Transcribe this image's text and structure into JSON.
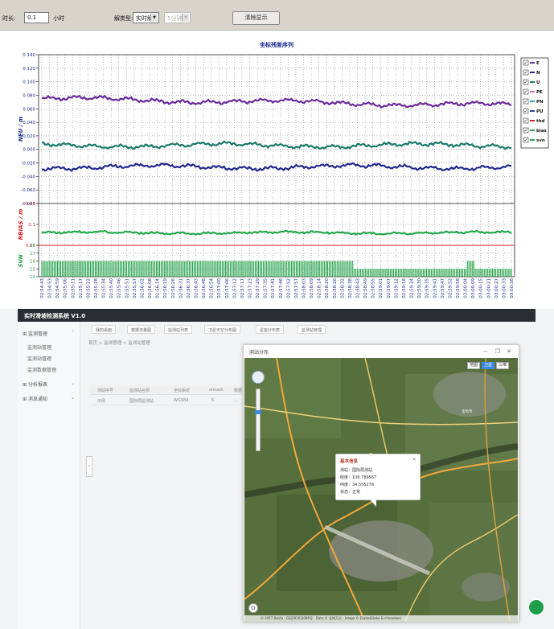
{
  "toolbar": {
    "duration_label": "时长:",
    "duration_value": "0.1",
    "duration_unit": "小时",
    "solution_label": "解类型:",
    "solution_value": "实时解",
    "interval_value": "5分钟",
    "clear_button": "清除显示"
  },
  "chart_data": {
    "type": "line",
    "title": "坐标残差序列",
    "panels": [
      {
        "ylabel": "NEU / m",
        "ylim": [
          -0.08,
          0.14
        ],
        "ticks": [
          -0.08,
          -0.06,
          -0.04,
          -0.02,
          0.0,
          0.02,
          0.04,
          0.06,
          0.08,
          0.1,
          0.12,
          0.14
        ],
        "tick_labels": [
          "-0.080",
          "-0.060",
          "-0.040",
          "-0.020",
          "0.000",
          "0.020",
          "0.040",
          "0.060",
          "0.080",
          "0.100",
          "0.120",
          "0.140"
        ]
      },
      {
        "ylabel": "RBIAS / m",
        "ylim": [
          0.05,
          0.15
        ],
        "ticks": [
          0.05,
          0.1,
          0.15
        ],
        "tick_labels": [
          "0.05",
          "0.1",
          "0.15"
        ]
      },
      {
        "ylabel": "SVN",
        "ylim": [
          14,
          18
        ],
        "ticks": [
          14,
          15,
          16,
          17,
          18
        ],
        "tick_labels": [
          "14",
          "15",
          "16",
          "17",
          "18"
        ]
      }
    ],
    "series": [
      {
        "name": "E",
        "panel": 0,
        "color": "#6a2a9c",
        "level": 0.075
      },
      {
        "name": "U",
        "panel": 0,
        "color": "#1a7a6a",
        "level": 0.006
      },
      {
        "name": "N",
        "panel": 0,
        "color": "#232a8f",
        "level": -0.026
      },
      {
        "name": "bias",
        "panel": 1,
        "color": "#22a84a",
        "level": 0.08
      },
      {
        "name": "thd",
        "panel": 1,
        "color": "#e02020",
        "level": 0.05
      },
      {
        "name": "svn",
        "panel": 2,
        "color": "#26a34a",
        "level": 16
      }
    ],
    "x_tick_labels": [
      "02:54:43",
      "02:54:53",
      "02:54:59",
      "02:55:06",
      "02:55:11",
      "02:55:17",
      "02:55:22",
      "02:55:28",
      "02:55:34",
      "02:55:40",
      "02:55:46",
      "02:55:51",
      "02:55:57",
      "02:56:02",
      "02:56:08",
      "02:56:14",
      "02:56:19",
      "02:56:26",
      "02:56:31",
      "02:56:37",
      "02:56:43",
      "02:56:48",
      "02:56:54",
      "02:57:00",
      "02:57:06",
      "02:57:12",
      "02:57:17",
      "02:57:23",
      "02:57:29",
      "02:57:35",
      "02:57:41",
      "02:57:46",
      "02:57:52",
      "02:57:57",
      "02:58:03",
      "02:58:09",
      "02:58:14",
      "02:58:20",
      "02:58:26",
      "02:58:32",
      "02:58:38",
      "02:58:43",
      "02:58:49",
      "02:58:55",
      "02:59:01",
      "02:59:07",
      "02:59:12",
      "02:59:18",
      "02:59:24",
      "02:59:30",
      "02:59:35",
      "02:59:41",
      "02:59:47",
      "02:59:52",
      "02:59:58",
      "03:00:04",
      "03:00:09",
      "03:00:15",
      "03:00:21",
      "03:00:27",
      "03:00:33",
      "03:00:38"
    ],
    "legend": [
      {
        "label": "E",
        "color": "#6a2a9c"
      },
      {
        "label": "N",
        "color": "#232a8f"
      },
      {
        "label": "U",
        "color": "#1a7a6a"
      },
      {
        "label": "PE",
        "color": "#e06ad0"
      },
      {
        "label": "PN",
        "color": "#22a4c4"
      },
      {
        "label": "PU",
        "color": "#2244aa"
      },
      {
        "label": "thd",
        "color": "#e02020"
      },
      {
        "label": "bias",
        "color": "#22a84a"
      },
      {
        "label": "svn",
        "color": "#26a34a"
      }
    ],
    "legend_placement": "right",
    "grid": true
  },
  "app": {
    "header_title": "实时滑坡检测系统 V1.0",
    "sidebar": [
      {
        "label": "监测管理",
        "expanded": true
      },
      {
        "label": "监测站管理",
        "sub": true
      },
      {
        "label": "监测站管理",
        "sub": true
      },
      {
        "label": "监测数据管理",
        "sub": true
      },
      {
        "label": "分析报表",
        "expanded": false
      },
      {
        "label": "消息通知",
        "expanded": false
      }
    ],
    "tabs": [
      "我的桌面",
      "数据流量图",
      "监测站列表",
      "卫星天空分布图",
      "星座分布表",
      "监测站管理"
    ],
    "breadcrumb": "首页 > 监测管理 > 监测站管理",
    "table": {
      "headers": [
        "测站序号",
        "监测站名称",
        "坐标系统",
        "elmask",
        "数据"
      ],
      "rows": [
        [
          "示例",
          "国际局监测站",
          "WGS84",
          "5",
          "..."
        ]
      ]
    },
    "dialog": {
      "title": "测站分布",
      "controls": "－ ❐ ✕",
      "map_types": [
        "地图",
        "卫星",
        "三维"
      ],
      "popup": {
        "title": "基本信息",
        "lines": [
          "测站：国际局测站",
          "经度：106.789567",
          "纬度：34.555276",
          "状态：正常"
        ]
      },
      "footer": "© 2017 Baidu · GS(2016)2089号 · Data © 长地万方 · Image © DigitalGlobe & chinasiwei"
    }
  }
}
